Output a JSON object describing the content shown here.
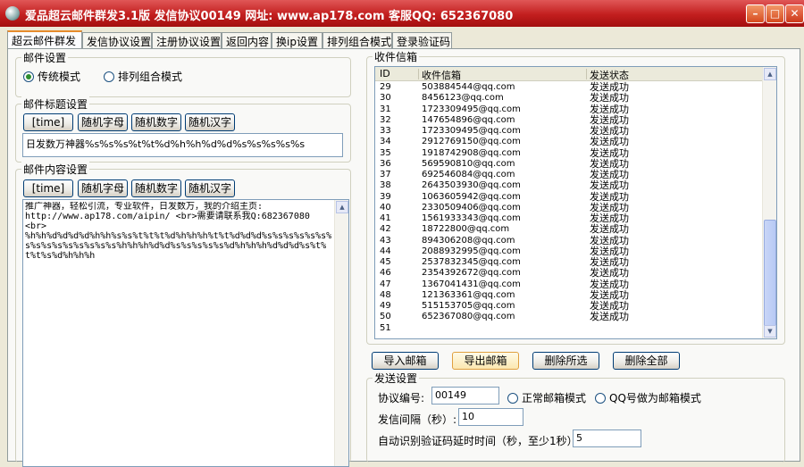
{
  "window": {
    "title": "爱品超云邮件群发3.1版  发信协议00149 网址: www.ap178.com 客服QQ: 652367080"
  },
  "tabs": [
    "超云邮件群发",
    "发信协议设置",
    "注册协议设置",
    "返回内容",
    "换ip设置",
    "排列组合模式",
    "登录验证码"
  ],
  "mail_settings": {
    "title": "邮件设置",
    "mode1": "传统模式",
    "mode2": "排列组合模式"
  },
  "subject": {
    "title": "邮件标题设置",
    "buttons": [
      "[time]",
      "随机字母",
      "随机数字",
      "随机汉字"
    ],
    "value": "日发数万神器%s%s%s%t%t%d%h%h%d%d%s%s%s%s%s"
  },
  "content": {
    "title": "邮件内容设置",
    "buttons": [
      "[time]",
      "随机字母",
      "随机数字",
      "随机汉字"
    ],
    "value": "推广神器，轻松引流，专业软件，日发数万，我的介绍主页:\nhttp://www.ap178.com/aipin/ <br>需要请联系我Q:682367080\n<br>\n%h%h%d%d%d%d%h%h%s%s%t%t%t%d%h%h%h%t%t%d%d%d%s%s%s%s%s%s%s%s%s%s%s%s%s%s%s%h%h%h%d%d%s%s%s%s%s%d%h%h%h%d%d%d%s%t%t%t%s%d%h%h%h"
  },
  "recipients": {
    "title": "收件信箱",
    "columns": [
      "ID",
      "收件信箱",
      "发送状态"
    ],
    "rows": [
      [
        "29",
        "503884544@qq.com",
        "发送成功"
      ],
      [
        "30",
        "8456123@qq.com",
        "发送成功"
      ],
      [
        "31",
        "1723309495@qq.com",
        "发送成功"
      ],
      [
        "32",
        "147654896@qq.com",
        "发送成功"
      ],
      [
        "33",
        "1723309495@qq.com",
        "发送成功"
      ],
      [
        "34",
        "2912769150@qq.com",
        "发送成功"
      ],
      [
        "35",
        "1918742908@qq.com",
        "发送成功"
      ],
      [
        "36",
        "569590810@qq.com",
        "发送成功"
      ],
      [
        "37",
        "692546084@qq.com",
        "发送成功"
      ],
      [
        "38",
        "2643503930@qq.com",
        "发送成功"
      ],
      [
        "39",
        "1063605942@qq.com",
        "发送成功"
      ],
      [
        "40",
        "2330509406@qq.com",
        "发送成功"
      ],
      [
        "41",
        "1561933343@qq.com",
        "发送成功"
      ],
      [
        "42",
        "18722800@qq.com",
        "发送成功"
      ],
      [
        "43",
        "894306208@qq.com",
        "发送成功"
      ],
      [
        "44",
        "2088932995@qq.com",
        "发送成功"
      ],
      [
        "45",
        "2537832345@qq.com",
        "发送成功"
      ],
      [
        "46",
        "2354392672@qq.com",
        "发送成功"
      ],
      [
        "47",
        "1367041431@qq.com",
        "发送成功"
      ],
      [
        "48",
        "121363361@qq.com",
        "发送成功"
      ],
      [
        "49",
        "515153705@qq.com",
        "发送成功"
      ],
      [
        "50",
        "652367080@qq.com",
        "发送成功"
      ],
      [
        "51",
        "",
        ""
      ]
    ]
  },
  "actions": [
    "导入邮箱",
    "导出邮箱",
    "删除所选",
    "删除全部"
  ],
  "send": {
    "title": "发送设置",
    "protocol_label": "协议编号:",
    "protocol_value": "00149",
    "opt1": "正常邮箱模式",
    "opt2": "QQ号做为邮箱模式",
    "interval_label": "发信间隔（秒）:",
    "interval_value": "10",
    "delay_label": "自动识别验证码延时时间（秒，至少1秒）:",
    "delay_value": "5"
  },
  "colors": {
    "titlebar": "#c21e1e",
    "tab_active_border": "#e68b2c",
    "status_text": "#000000"
  }
}
